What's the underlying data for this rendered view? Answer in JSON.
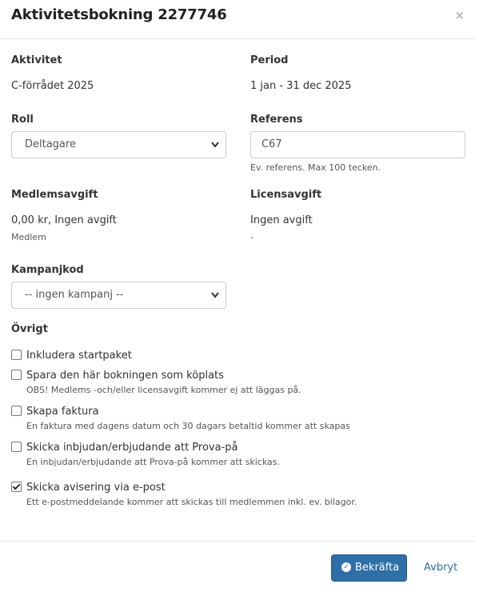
{
  "modal": {
    "title": "Aktivitetsbokning 2277746",
    "close_glyph": "×"
  },
  "activity": {
    "label": "Aktivitet",
    "value": "C-förrådet 2025"
  },
  "period": {
    "label": "Period",
    "value": "1 jan - 31 dec 2025"
  },
  "role": {
    "label": "Roll",
    "selected": "Deltagare",
    "chevron_icon": "chevron-down-icon"
  },
  "reference": {
    "label": "Referens",
    "value": "C67",
    "help": "Ev. referens. Max 100 tecken."
  },
  "member_fee": {
    "label": "Medlemsavgift",
    "value": "0,00 kr, Ingen avgift",
    "sub": "Medlem"
  },
  "license_fee": {
    "label": "Licensavgift",
    "value": "Ingen avgift",
    "sub": "-"
  },
  "campaign": {
    "label": "Kampanjkod",
    "selected": "-- ingen kampanj --"
  },
  "other": {
    "label": "Övrigt",
    "options": [
      {
        "label": "Inkludera startpaket",
        "checked": false,
        "help": ""
      },
      {
        "label": "Spara den här bokningen som köplats",
        "checked": false,
        "help": "OBS! Medlems -och/eller licensavgift kommer ej att läggas på."
      },
      {
        "label": "Skapa faktura",
        "checked": false,
        "help": "En faktura med dagens datum och 30 dagars betaltid kommer att skapas"
      },
      {
        "label": "Skicka inbjudan/erbjudande att Prova-på",
        "checked": false,
        "help": "En inbjudan/erbjudande att Prova-på kommer att skickas."
      },
      {
        "label": "Skicka avisering via e-post",
        "checked": true,
        "help": "Ett e-postmeddelande kommer att skickas till medlemmen inkl. ev. bilagor."
      }
    ]
  },
  "footer": {
    "confirm_label": "Bekräfta",
    "confirm_icon": "check-circle-icon",
    "cancel_label": "Avbryt"
  },
  "colors": {
    "primary": "#2f6fa8",
    "border": "#cccccc",
    "text": "#333333"
  }
}
